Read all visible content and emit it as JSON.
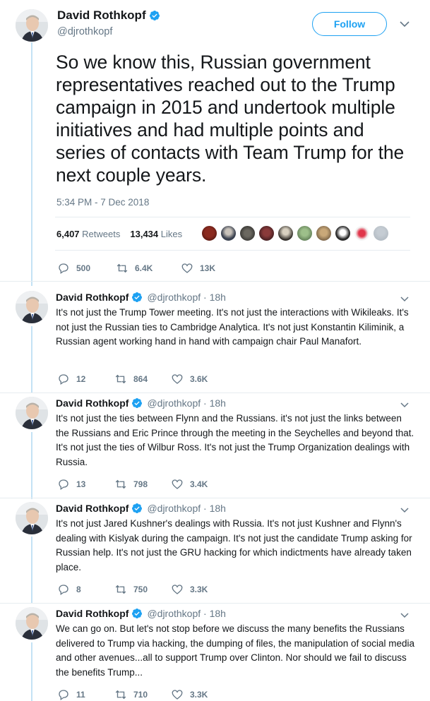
{
  "main_tweet": {
    "display_name": "David Rothkopf",
    "handle": "@djrothkopf",
    "follow_label": "Follow",
    "text": "So we know this, Russian government representatives reached out to the Trump campaign in 2015 and undertook multiple initiatives and had multiple points and series of contacts with Team Trump for the next couple years.",
    "timestamp": "5:34 PM - 7 Dec 2018",
    "retweets_count": "6,407",
    "retweets_label": "Retweets",
    "likes_count": "13,434",
    "likes_label": "Likes",
    "reply_count": "500",
    "retweet_count_short": "6.4K",
    "like_count_short": "13K"
  },
  "replies": [
    {
      "display_name": "David Rothkopf",
      "meta": "@djrothkopf · 18h",
      "text": "It's not just the Trump Tower meeting.  It's not just the interactions with Wikileaks.  It's not just the Russian ties to Cambridge Analytica.  It's not just Konstantin Kiliminik, a Russian agent working hand in hand with campaign chair Paul Manafort.",
      "replies": "12",
      "retweets": "864",
      "likes": "3.6K"
    },
    {
      "display_name": "David Rothkopf",
      "meta": "@djrothkopf · 18h",
      "text": "It's not just the ties between Flynn and the Russians.  it's not just the links between the Russians and Eric Prince through the meeting in the Seychelles and beyond that.  It's not just the ties of Wilbur Ross.  It's not just the Trump Organization dealings with Russia.",
      "replies": "13",
      "retweets": "798",
      "likes": "3.4K"
    },
    {
      "display_name": "David Rothkopf",
      "meta": "@djrothkopf · 18h",
      "text": "It's not just Jared Kushner's dealings with Russia.  It's not just Kushner and Flynn's dealing with Kislyak during the campaign.  It's not just the candidate Trump asking for Russian help.  It's not just the GRU hacking for which indictments have already taken place.",
      "replies": "8",
      "retweets": "750",
      "likes": "3.3K"
    },
    {
      "display_name": "David Rothkopf",
      "meta": "@djrothkopf · 18h",
      "text": "We can go on.  But let's not stop before we discuss the many benefits the Russians delivered to Trump via hacking, the dumping of files, the manipulation of social media and other avenues...all to support Trump over Clinton.  Nor should we fail to discuss the benefits Trump...",
      "replies": "11",
      "retweets": "710",
      "likes": "3.3K"
    }
  ],
  "colors": {
    "accent": "#1da1f2",
    "secondary_text": "#657786",
    "thread_line": "#c4e2f5"
  },
  "icons": [
    "verified-badge-icon",
    "chevron-down-icon",
    "reply-icon",
    "retweet-icon",
    "like-icon"
  ]
}
